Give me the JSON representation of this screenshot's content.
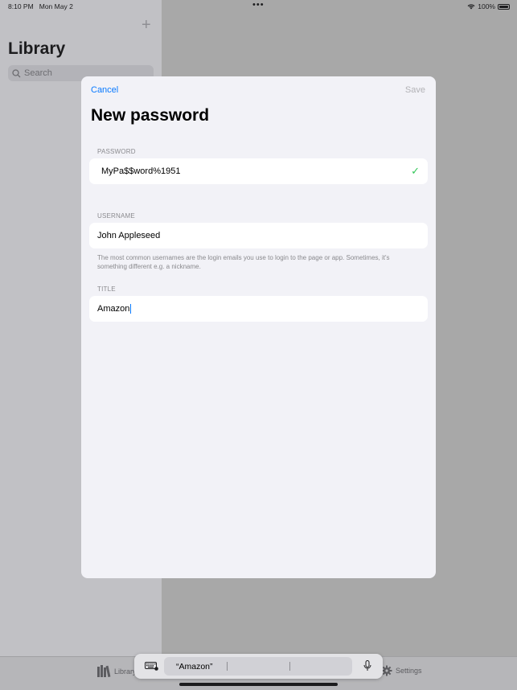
{
  "status": {
    "time": "8:10 PM",
    "date": "Mon May 2",
    "dots": "•••",
    "battery": "100%"
  },
  "sidebar": {
    "title": "Library",
    "search_placeholder": "Search"
  },
  "tabbar": {
    "library_label": "Library",
    "settings_label": "Settings"
  },
  "sheet": {
    "cancel": "Cancel",
    "save": "Save",
    "title": "New password",
    "password_label": "PASSWORD",
    "password_value": "MyPa$$word%1951",
    "username_label": "USERNAME",
    "username_value": "John Appleseed",
    "username_footnote": "The most common usernames are the login emails you use to login to the page or app. Sometimes, it's something different e.g. a nickname.",
    "title_label": "TITLE",
    "title_value": "Amazon"
  },
  "keyboard": {
    "suggestion": "“Amazon”"
  },
  "colors": {
    "accent": "#0a7aff",
    "valid": "#34c759"
  }
}
